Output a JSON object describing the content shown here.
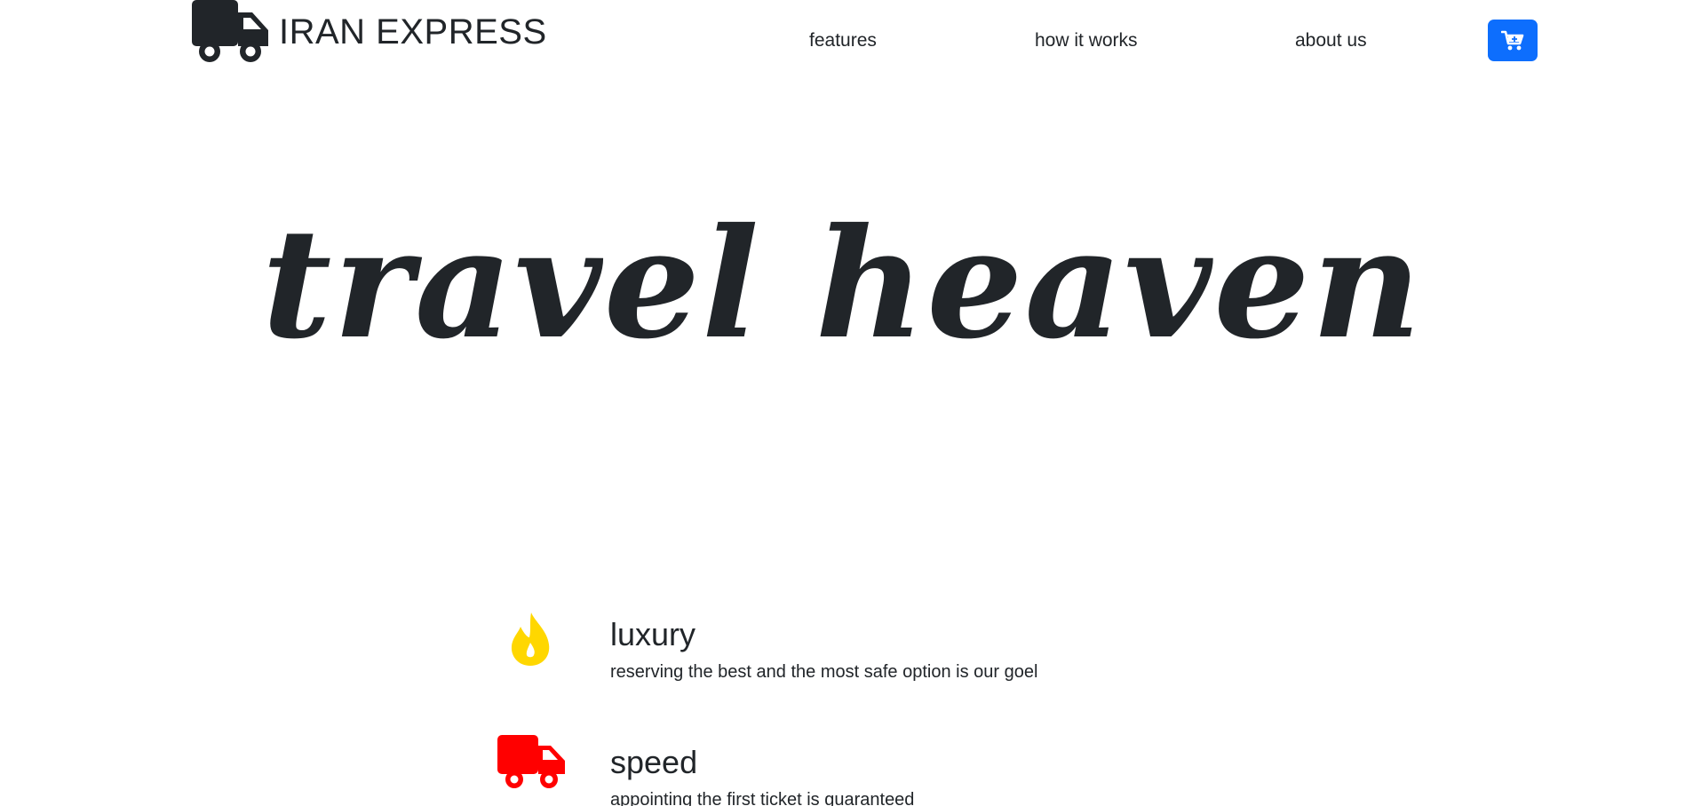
{
  "header": {
    "brand": {
      "name": "IRAN EXPRESS",
      "icon": "truck-icon"
    },
    "nav": [
      {
        "label": "features"
      },
      {
        "label": "how it works"
      },
      {
        "label": "about us"
      }
    ],
    "cart": {
      "icon": "cart-icon",
      "color": "#0d6efd"
    }
  },
  "hero": {
    "title": "travel heaven"
  },
  "features": [
    {
      "icon": "fire-icon",
      "icon_color": "#ffd700",
      "title": "luxury",
      "text": "reserving the best and the most safe option is our goel"
    },
    {
      "icon": "truck-icon",
      "icon_color": "#ff0000",
      "title": "speed",
      "text": "appointing the first ticket is guaranteed"
    }
  ]
}
